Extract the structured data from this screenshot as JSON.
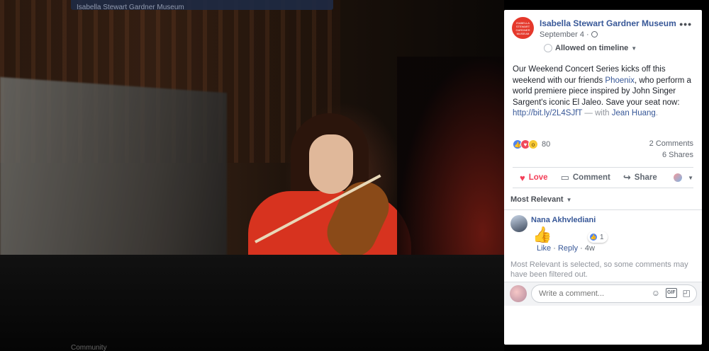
{
  "viewer": {
    "top_bar_text": "Isabella Stewart Gardner Museum",
    "bottom_text": "Community"
  },
  "post": {
    "page_name": "Isabella Stewart Gardner Museum",
    "avatar_text": "ISABELLA STEWART GARDNER MUSEUM",
    "date": "September 4 ·",
    "more_label": "•••",
    "timeline_label": "Allowed on timeline",
    "text_part1": "Our Weekend Concert Series kicks off this weekend with our friends ",
    "text_link_phoenix": "Phoenix",
    "text_part2": ", who perform a world premiere piece inspired by John Singer Sargent's iconic El Jaleo. Save your seat now: ",
    "text_link_url": "http://bit.ly/2L4SJfT",
    "text_with": " — with ",
    "text_link_person": "Jean Huang",
    "text_end": "."
  },
  "stats": {
    "reaction_count": "80",
    "comments": "2 Comments",
    "shares": "6 Shares"
  },
  "actions": {
    "love": "Love",
    "comment": "Comment",
    "share": "Share"
  },
  "comments_section": {
    "sort_label": "Most Relevant",
    "comment": {
      "author": "Nana Akhvlediani",
      "content": "👍",
      "reaction_count": "1",
      "like": "Like",
      "reply": "Reply",
      "age": "4w"
    },
    "filter_note": "Most Relevant is selected, so some comments may have been filtered out.",
    "compose_placeholder": "Write a comment..."
  }
}
